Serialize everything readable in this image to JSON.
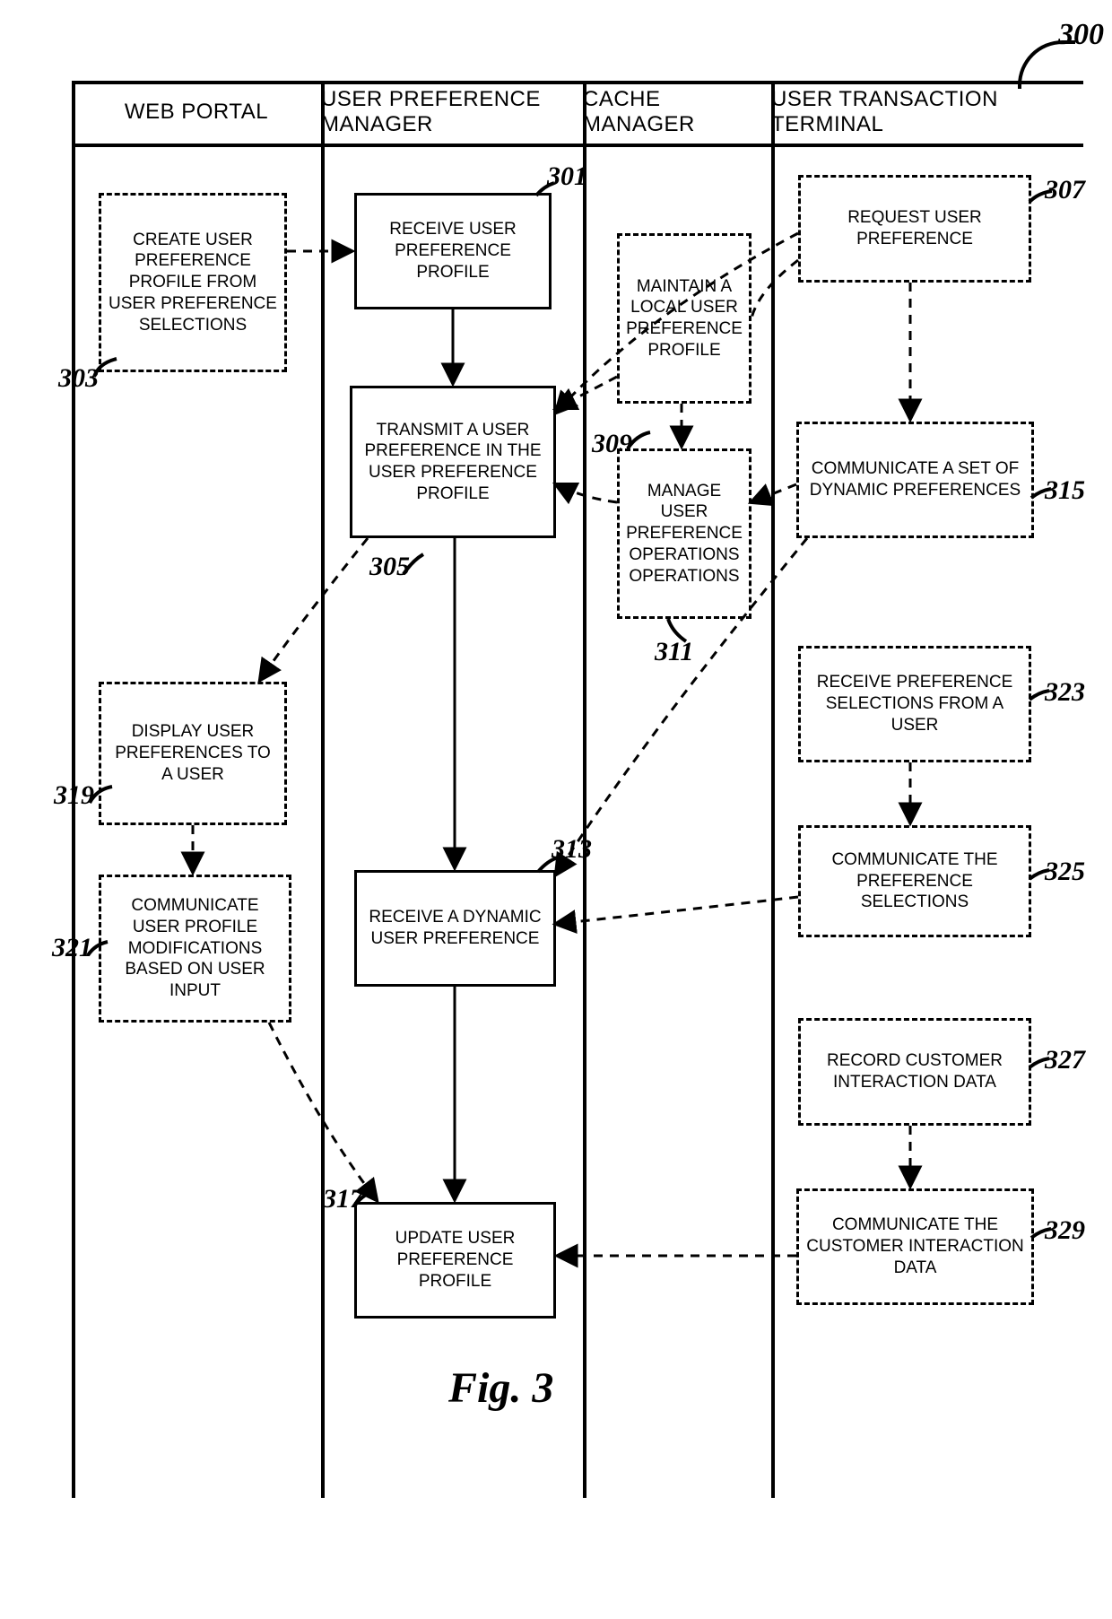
{
  "figure": {
    "number_ref": "300",
    "caption": "Fig. 3"
  },
  "columns": {
    "web_portal": "WEB PORTAL",
    "user_pref_manager": "USER PREFERENCE MANAGER",
    "cache_manager": "CACHE MANAGER",
    "user_transaction_terminal": "USER TRANSACTION TERMINAL"
  },
  "nodes": {
    "n301": {
      "ref": "301",
      "text": "RECEIVE USER PREFERENCE PROFILE",
      "dashed": false
    },
    "n303": {
      "ref": "303",
      "text": "CREATE USER PREFERENCE PROFILE FROM USER PREFERENCE SELECTIONS",
      "dashed": true
    },
    "n305": {
      "ref": "305",
      "text": "TRANSMIT A USER PREFERENCE IN THE USER PREFERENCE PROFILE",
      "dashed": false
    },
    "n307": {
      "ref": "307",
      "text": "REQUEST USER PREFERENCE",
      "dashed": true
    },
    "n309": {
      "ref": "309",
      "text": "MAINTAIN A LOCAL USER PREFERENCE PROFILE",
      "dashed": true
    },
    "n311": {
      "ref": "311",
      "text": "MANAGE USER PREFERENCE OPERATIONS OPERATIONS",
      "dashed": true
    },
    "n313": {
      "ref": "313",
      "text": "RECEIVE A DYNAMIC USER PREFERENCE",
      "dashed": false
    },
    "n315": {
      "ref": "315",
      "text": "COMMUNICATE A SET OF DYNAMIC PREFERENCES",
      "dashed": true
    },
    "n317": {
      "ref": "317",
      "text": "UPDATE USER PREFERENCE PROFILE",
      "dashed": false
    },
    "n319": {
      "ref": "319",
      "text": "DISPLAY USER PREFERENCES TO A USER",
      "dashed": true
    },
    "n321": {
      "ref": "321",
      "text": "COMMUNICATE USER PROFILE MODIFICATIONS BASED ON USER INPUT",
      "dashed": true
    },
    "n323": {
      "ref": "323",
      "text": "RECEIVE PREFERENCE SELECTIONS FROM A USER",
      "dashed": true
    },
    "n325": {
      "ref": "325",
      "text": "COMMUNICATE THE PREFERENCE SELECTIONS",
      "dashed": true
    },
    "n327": {
      "ref": "327",
      "text": "RECORD CUSTOMER INTERACTION DATA",
      "dashed": true
    },
    "n329": {
      "ref": "329",
      "text": "COMMUNICATE THE CUSTOMER INTERACTION DATA",
      "dashed": true
    }
  }
}
